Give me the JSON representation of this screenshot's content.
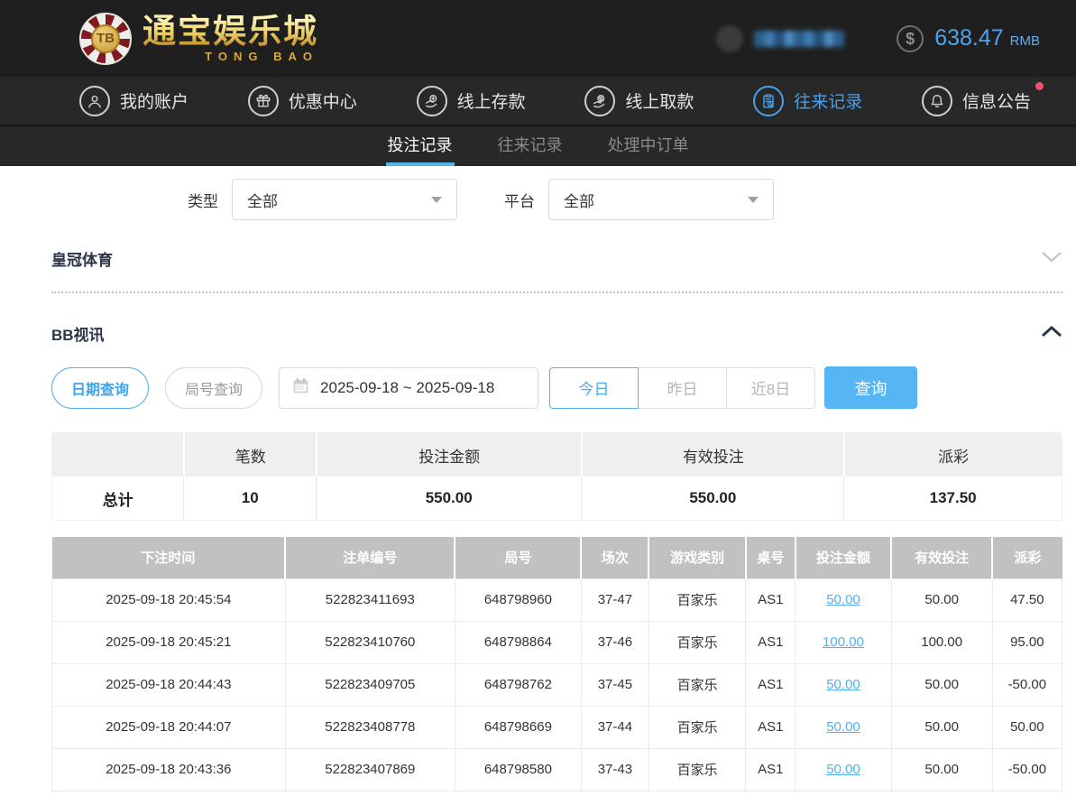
{
  "header": {
    "logo": {
      "chip_text": "TB",
      "brand": "通宝娱乐城",
      "brand_sub": "TONG BAO"
    },
    "balance": {
      "currency_symbol": "$",
      "amount": "638.47",
      "currency": "RMB"
    }
  },
  "nav": {
    "items": [
      {
        "label": "我的账户",
        "icon": "user-icon"
      },
      {
        "label": "优惠中心",
        "icon": "gift-icon"
      },
      {
        "label": "线上存款",
        "icon": "deposit-icon"
      },
      {
        "label": "线上取款",
        "icon": "withdraw-icon"
      },
      {
        "label": "往来记录",
        "icon": "records-icon",
        "active": true
      },
      {
        "label": "信息公告",
        "icon": "bell-icon",
        "badge": true
      }
    ]
  },
  "tabs": {
    "items": [
      {
        "label": "投注记录",
        "active": true
      },
      {
        "label": "往来记录",
        "active": false
      },
      {
        "label": "处理中订单",
        "active": false
      }
    ]
  },
  "filters": {
    "type": {
      "label": "类型",
      "value": "全部"
    },
    "platform": {
      "label": "平台",
      "value": "全部"
    }
  },
  "sections": {
    "crown_sports": "皇冠体育",
    "bb_video": "BB视讯"
  },
  "controls": {
    "date_query": "日期查询",
    "round_query": "局号查询",
    "date_range": "2025-09-18 ~ 2025-09-18",
    "today": "今日",
    "yesterday": "昨日",
    "last8days": "近8日",
    "search": "查询"
  },
  "summary": {
    "headers": {
      "count": "笔数",
      "bet_amount": "投注金额",
      "valid_bet": "有效投注",
      "payout": "派彩"
    },
    "total_label": "总计",
    "count": "10",
    "bet_amount": "550.00",
    "valid_bet": "550.00",
    "payout": "137.50"
  },
  "table": {
    "headers": [
      "下注时间",
      "注单编号",
      "局号",
      "场次",
      "游戏类别",
      "桌号",
      "投注金额",
      "有效投注",
      "派彩"
    ],
    "rows": [
      [
        "2025-09-18 20:45:54",
        "522823411693",
        "648798960",
        "37-47",
        "百家乐",
        "AS1",
        "50.00",
        "50.00",
        "47.50"
      ],
      [
        "2025-09-18 20:45:21",
        "522823410760",
        "648798864",
        "37-46",
        "百家乐",
        "AS1",
        "100.00",
        "100.00",
        "95.00"
      ],
      [
        "2025-09-18 20:44:43",
        "522823409705",
        "648798762",
        "37-45",
        "百家乐",
        "AS1",
        "50.00",
        "50.00",
        "-50.00"
      ],
      [
        "2025-09-18 20:44:07",
        "522823408778",
        "648798669",
        "37-44",
        "百家乐",
        "AS1",
        "50.00",
        "50.00",
        "50.00"
      ],
      [
        "2025-09-18 20:43:36",
        "522823407869",
        "648798580",
        "37-43",
        "百家乐",
        "AS1",
        "50.00",
        "50.00",
        "-50.00"
      ]
    ]
  },
  "colors": {
    "accent_blue": "#55b3f0",
    "negative_red": "#fb4d6d",
    "active_nav_blue": "#4aa0e8"
  }
}
